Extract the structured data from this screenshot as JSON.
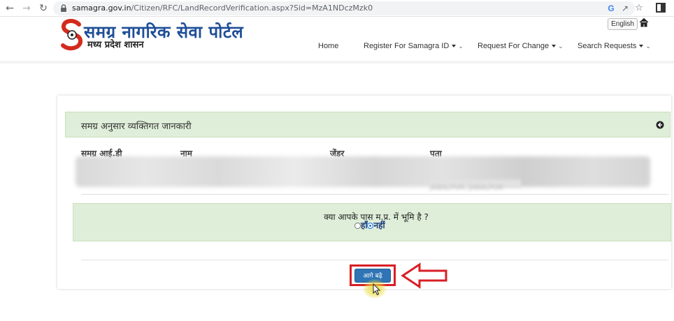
{
  "browser": {
    "url_host": "samagra.gov.in",
    "url_path": "/Citizen/RFC/LandRecordVerification.aspx?Sid=MzA1NDczMzk0",
    "google_icon": "G"
  },
  "header": {
    "brand_title": "समग्र नागरिक सेवा पोर्टल",
    "brand_subtitle": "मध्य प्रदेश शासन",
    "language_button": "English",
    "nav": {
      "home": "Home",
      "register": "Register For Samagra ID",
      "request_change": "Request For Change",
      "search_requests": "Search Requests"
    }
  },
  "panel": {
    "title": "समग्र अनुसार व्यक्तिगत जानकारी",
    "columns": [
      "समग्र आई.डी",
      "नाम",
      "जेंडर",
      "पता"
    ],
    "address_visible_fragment": "JABALPUR, JABALPUR"
  },
  "question": {
    "text": "क्या आपके पास म.प्र. में भूमि है ?",
    "options": [
      {
        "label": "हाँ",
        "selected": false
      },
      {
        "label": "नहीं",
        "selected": true
      }
    ]
  },
  "actions": {
    "next_button": "आगे बढ़े"
  },
  "colors": {
    "brand_blue": "#1f4e98",
    "panel_green": "#dfeed9",
    "button_blue": "#2f75b5",
    "highlight_red": "#d81f26"
  },
  "icons": {
    "back": "arrow-left-icon",
    "forward": "arrow-right-icon",
    "reload": "reload-icon",
    "lock": "lock-icon",
    "share": "share-icon",
    "bookmark": "star-icon",
    "sidebar": "sidebar-icon",
    "home": "home-icon",
    "collapse": "circle-arrow-icon",
    "logo": "samagra-logo-icon",
    "pointer": "red-arrow-icon",
    "cursor": "mouse-cursor-icon"
  }
}
